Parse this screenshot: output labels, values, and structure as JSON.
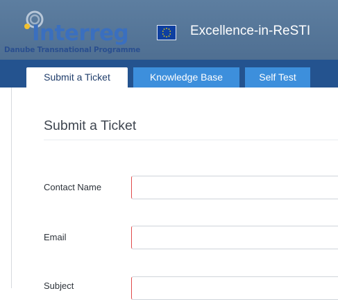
{
  "header": {
    "logo_word": "Interreg",
    "logo_sub": "Danube Transnational Programme",
    "site_title": "Excellence-in-ReSTI",
    "colors": {
      "header_bg": "#5d7ea0",
      "nav_bg": "#24538f",
      "tab_bg": "#3d8fdc"
    }
  },
  "nav": {
    "tabs": [
      {
        "label": "Submit a Ticket",
        "active": true
      },
      {
        "label": "Knowledge Base",
        "active": false
      },
      {
        "label": "Self Test",
        "active": false
      }
    ]
  },
  "form": {
    "title": "Submit a Ticket",
    "fields": [
      {
        "label": "Contact Name",
        "value": ""
      },
      {
        "label": "Email",
        "value": ""
      },
      {
        "label": "Subject",
        "value": ""
      }
    ]
  }
}
